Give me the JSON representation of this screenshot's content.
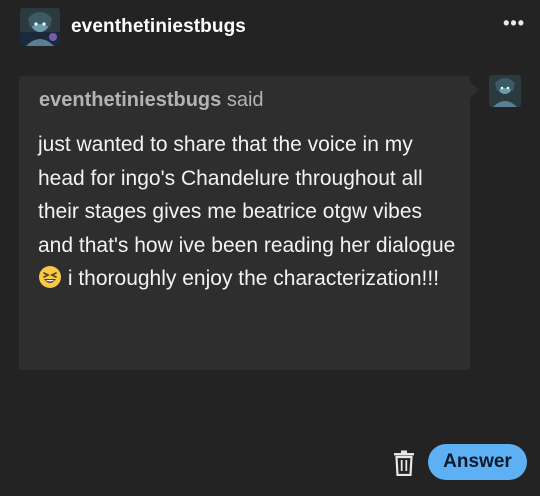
{
  "post": {
    "username": "eventhetiniestbugs",
    "more_icon": "ellipsis-icon",
    "more_label": "•••"
  },
  "ask": {
    "asker_name": "eventhetiniestbugs",
    "asker_suffix": " said",
    "question_part1": "just wanted to share that the voice in my head for ingo's Chandelure throughout all their stages gives me beatrice otgw vibes and that's how ive been reading her dialogue ",
    "emoji": "grinning-squinting-face-emoji",
    "question_part2": " i thoroughly enjoy the characterization!!!"
  },
  "actions": {
    "delete_icon": "trash-icon",
    "answer_label": "Answer"
  },
  "colors": {
    "background": "#232323",
    "ask_bubble": "#2e2e2e",
    "answer_button": "#5eb0f5",
    "asker_text": "#b3b3b3"
  }
}
